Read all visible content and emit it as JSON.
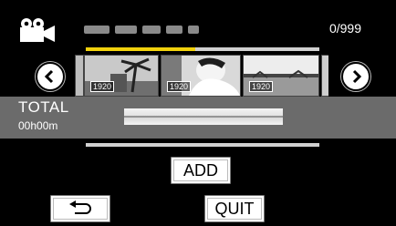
{
  "header": {
    "mode_icon": "video-camera-icon",
    "counter": "0/999"
  },
  "selection_progress": 0.47,
  "strip": {
    "prev_icon": "chevron-left-icon",
    "next_icon": "chevron-right-icon",
    "thumbnails": [
      {
        "resolution": "1920",
        "icon": "palm-tree-thumbnail"
      },
      {
        "resolution": "1920",
        "icon": "person-portrait-thumbnail"
      },
      {
        "resolution": "1920",
        "icon": "landscape-thumbnail"
      }
    ]
  },
  "total": {
    "label": "TOTAL",
    "time": "00h00m"
  },
  "buttons": {
    "add": "ADD",
    "back_icon": "return-arrow-icon",
    "quit": "QUIT"
  },
  "colors": {
    "background": "#000000",
    "band": "#6b6b6b",
    "progress": "#f2d20c"
  }
}
